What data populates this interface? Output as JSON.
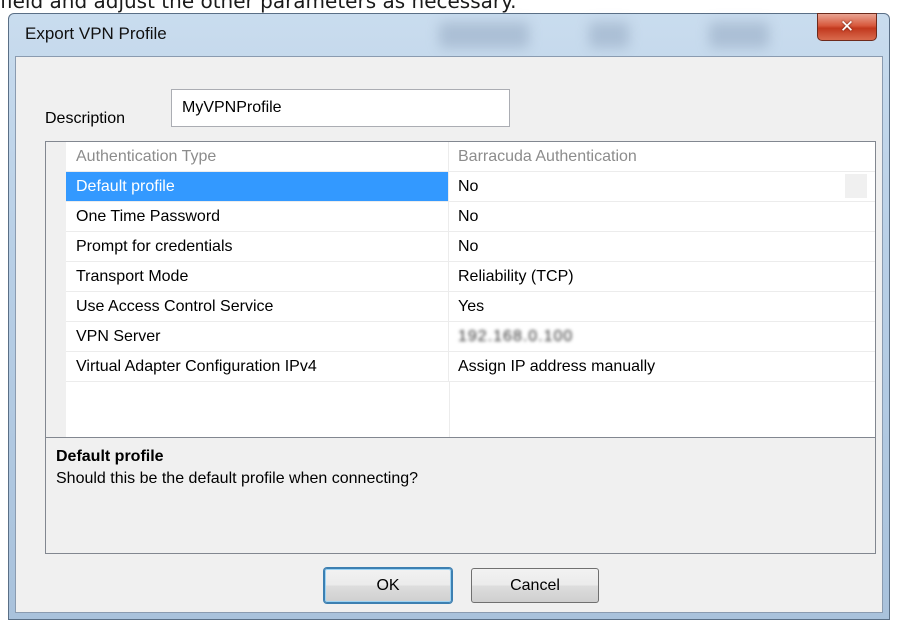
{
  "background_text": "field and adjust the other parameters as necessary.",
  "window": {
    "title": "Export VPN Profile",
    "close_glyph": "✕"
  },
  "description": {
    "label": "Description",
    "value": "MyVPNProfile"
  },
  "properties": [
    {
      "name": "Authentication Type",
      "value": "Barracuda Authentication",
      "state": "disabled"
    },
    {
      "name": "Default profile",
      "value": "No",
      "state": "selected"
    },
    {
      "name": "One Time Password",
      "value": "No",
      "state": "normal"
    },
    {
      "name": "Prompt for credentials",
      "value": "No",
      "state": "normal"
    },
    {
      "name": "Transport Mode",
      "value": "Reliability (TCP)",
      "state": "normal"
    },
    {
      "name": "Use Access Control Service",
      "value": "Yes",
      "state": "normal"
    },
    {
      "name": "VPN Server",
      "value": "192.168.0.100",
      "state": "blurred"
    },
    {
      "name": "Virtual Adapter Configuration IPv4",
      "value": "Assign IP address manually",
      "state": "normal"
    }
  ],
  "help": {
    "title": "Default profile",
    "text": "Should this be the default profile when connecting?"
  },
  "buttons": {
    "ok_label": "OK",
    "cancel_label": "Cancel"
  },
  "colors": {
    "selection": "#3399ff",
    "close_button": "#c2391e"
  }
}
